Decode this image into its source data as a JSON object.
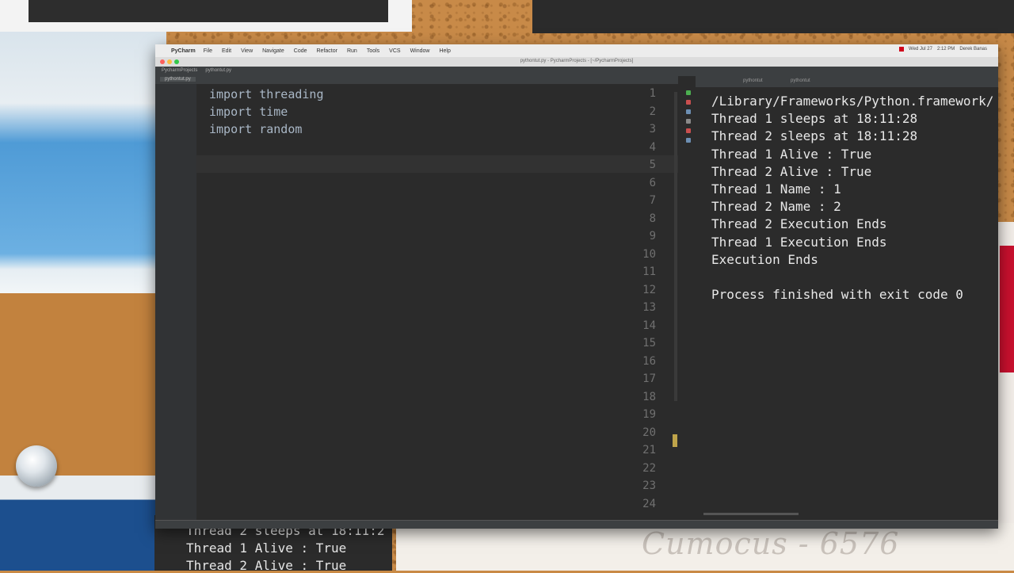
{
  "menubar": {
    "app": "PyCharm",
    "items": [
      "File",
      "Edit",
      "View",
      "Navigate",
      "Code",
      "Refactor",
      "Run",
      "Tools",
      "VCS",
      "Window",
      "Help"
    ],
    "status": [
      "Wed Jul 27",
      "2:12 PM",
      "Derek Banas"
    ]
  },
  "window": {
    "title": "pythontut.py - PycharmProjects - [~/PycharmProjects]"
  },
  "navbar": {
    "crumbs": [
      "PycharmProjects",
      "pythontut.py"
    ]
  },
  "tab": {
    "label": "pythontut.py"
  },
  "run_panel": {
    "tabs": [
      "pythontut",
      "pythontut"
    ]
  },
  "editor": {
    "line_numbers": [
      "1",
      "2",
      "3",
      "4",
      "5",
      "6",
      "7",
      "8",
      "9",
      "10",
      "11",
      "12",
      "13",
      "14",
      "15",
      "16",
      "17",
      "18",
      "19",
      "20",
      "21",
      "22",
      "23",
      "24"
    ],
    "lines": [
      "import threading",
      "import time",
      "import random"
    ]
  },
  "console": {
    "lines": [
      "/Library/Frameworks/Python.framework/",
      "Thread 1 sleeps at 18:11:28",
      "Thread 2 sleeps at 18:11:28",
      "Thread 1 Alive : True",
      "Thread 2 Alive : True",
      "Thread 1 Name : 1",
      "Thread 2 Name : 2",
      "Thread 2 Execution Ends",
      "Thread 1 Execution Ends",
      "Execution Ends",
      "",
      "Process finished with exit code 0"
    ]
  },
  "background_console": {
    "lines": [
      "Thread 2 sleeps at 18:11:2",
      "Thread 1 Alive : True",
      "Thread 2 Alive : True"
    ]
  },
  "background_paper": {
    "script_text": "Cumocus - 6576"
  },
  "colors": {
    "editor_bg": "#2b2b2b",
    "code_text": "#a9b7c6",
    "line_number": "#707070",
    "console_text": "#e8e8e8"
  }
}
